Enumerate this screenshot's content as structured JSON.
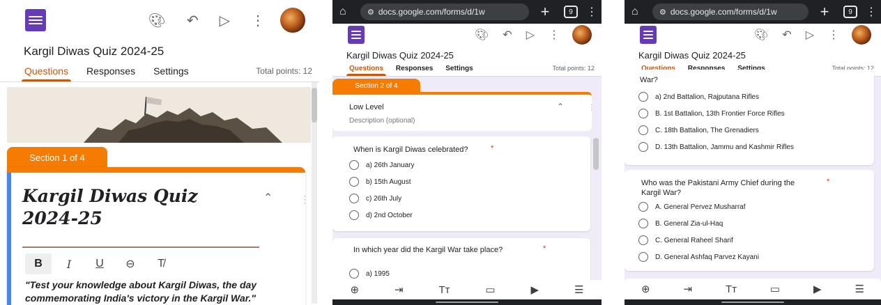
{
  "form": {
    "title": "Kargil Diwas Quiz 2024-25",
    "tabs": [
      "Questions",
      "Responses",
      "Settings"
    ],
    "total_points": "Total points: 12"
  },
  "browser": {
    "url": "docs.google.com/forms/d/1w",
    "tab_count": "9"
  },
  "icons": {
    "palette": "palette-icon",
    "undo": "undo-icon",
    "send": "send-icon",
    "more": "more-vert-icon"
  },
  "panel1": {
    "section_label": "Section 1 of 4",
    "big_title": "Kargil Diwas Quiz 2024-25",
    "format_buttons": [
      "B",
      "I",
      "U"
    ],
    "description": "\"Test your knowledge about Kargil Diwas, the day commemorating India's victory in the Kargil War.\""
  },
  "panel2": {
    "section_label": "Section 2 of 4",
    "section_title": "Low Level",
    "section_desc_placeholder": "Description (optional)",
    "q1": {
      "text": "When is Kargil Diwas celebrated?",
      "required": "*",
      "options": [
        "a) 26th January",
        "b) 15th August",
        "c) 26th July",
        "d) 2nd October"
      ]
    },
    "q2": {
      "text": "In which year did the Kargil War take place?",
      "required": "*",
      "options": [
        "a) 1995"
      ]
    }
  },
  "panel3": {
    "q_prev_tail": "War?",
    "q_prev_options": [
      "a) 2nd Battalion, Rajputana Rifles",
      "B. 1st Battalion, 13th Frontier Force Rifles",
      "C. 18th Battalion, The Grenadiers",
      "D. 13th Battalion, Jammu and Kashmir Rifles"
    ],
    "q_next": {
      "text": "Who was the Pakistani Army Chief during the Kargil War?",
      "required": "*",
      "options": [
        "A. General Pervez Musharraf",
        "B. General Zia-ul-Haq",
        "C. General Raheel Sharif",
        "D. General Ashfaq Parvez Kayani"
      ]
    }
  },
  "bottom_toolbar": [
    "add-question-icon",
    "import-questions-icon",
    "add-title-icon",
    "add-image-icon",
    "add-video-icon",
    "add-section-icon"
  ]
}
